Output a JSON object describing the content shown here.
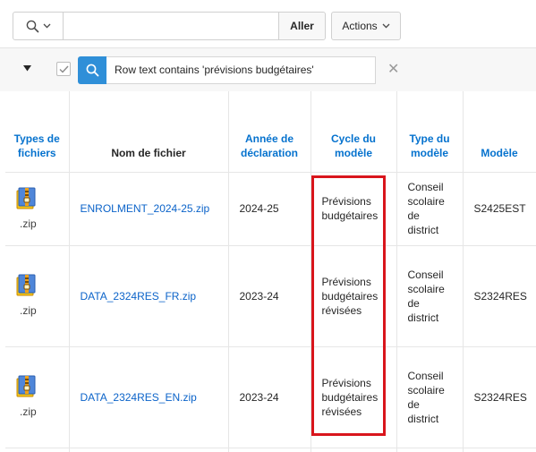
{
  "toolbar": {
    "search_menu_icon": "magnifier-icon",
    "search_value": "",
    "go_label": "Aller",
    "actions_label": "Actions"
  },
  "filter": {
    "enabled": true,
    "text": "Row text contains 'prévisions budgétaires'"
  },
  "columns": [
    {
      "label": "Types de fichiers",
      "sortable": true
    },
    {
      "label": "Nom de fichier",
      "sortable": false
    },
    {
      "label": "Année de déclaration",
      "sortable": true
    },
    {
      "label": "Cycle du modèle",
      "sortable": true
    },
    {
      "label": "Type du modèle",
      "sortable": true
    },
    {
      "label": "Modèle",
      "sortable": true
    }
  ],
  "rows": [
    {
      "type_icon": "zip-archive-icon",
      "type_ext": ".zip",
      "file_name": "ENROLMENT_2024-25.zip",
      "year": "2024-25",
      "cycle": "Prévisions budgétaires",
      "model_type": "Conseil scolaire de district",
      "model": "S2425EST"
    },
    {
      "type_icon": "zip-archive-icon",
      "type_ext": ".zip",
      "file_name": "DATA_2324RES_FR.zip",
      "year": "2023-24",
      "cycle": "Prévisions budgétaires révisées",
      "model_type": "Conseil scolaire de district",
      "model": "S2324RES"
    },
    {
      "type_icon": "zip-archive-icon",
      "type_ext": ".zip",
      "file_name": "DATA_2324RES_EN.zip",
      "year": "2023-24",
      "cycle": "Prévisions budgétaires révisées",
      "model_type": "Conseil scolaire de district",
      "model": "S2324RES"
    }
  ],
  "colors": {
    "link": "#0b63c9",
    "header_link": "#0572ce",
    "filter_search_bg": "#2f8fd8",
    "highlight": "#d9151c"
  }
}
